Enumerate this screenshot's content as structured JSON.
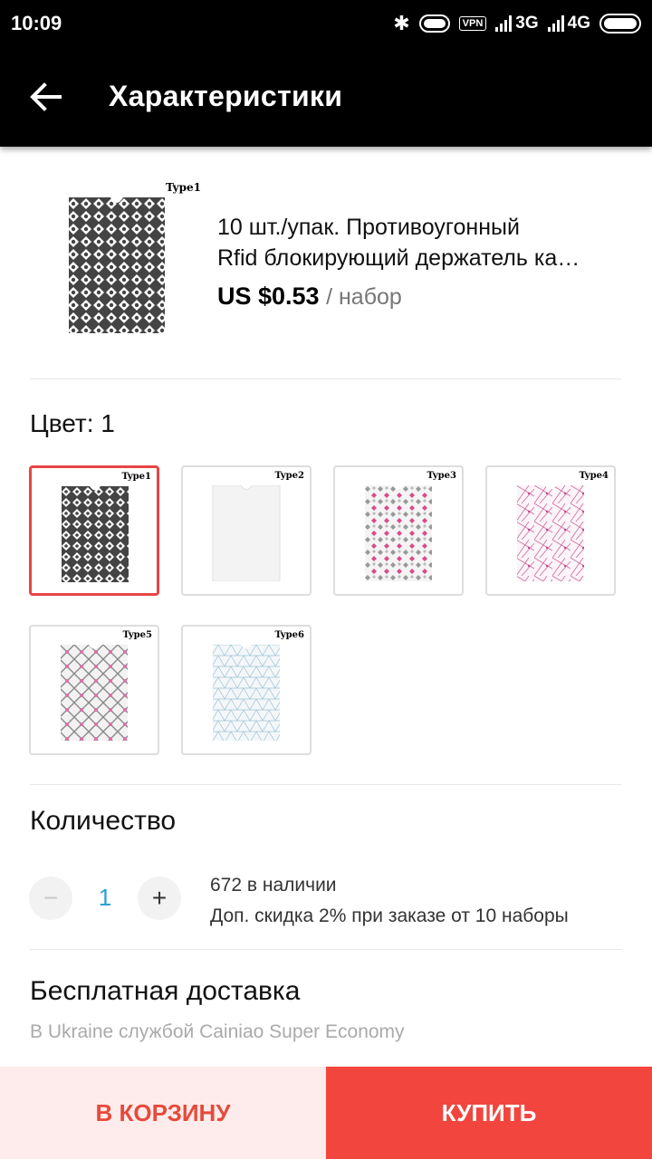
{
  "status_bar": {
    "time": "10:09",
    "vpn_label": "VPN",
    "network_1": "3G",
    "network_2": "4G",
    "icons": [
      "bluetooth-icon",
      "toggle-icon",
      "vpn-icon",
      "signal-icon",
      "signal-icon",
      "battery-icon"
    ]
  },
  "app_bar": {
    "title": "Характеристики",
    "back_icon": "arrow-left-icon"
  },
  "product": {
    "image_label": "Type1",
    "name_line1": "10 шт./упак. Противоугонный",
    "name_line2": "Rfid блокирующий держатель ка…",
    "price": "US $0.53",
    "unit": "/ набор"
  },
  "color": {
    "label": "Цвет: 1",
    "selected": "Type1",
    "options": [
      {
        "label": "Type1",
        "style": "dark-geometric"
      },
      {
        "label": "Type2",
        "style": "plain-white"
      },
      {
        "label": "Type3",
        "style": "grey-pink-diamonds"
      },
      {
        "label": "Type4",
        "style": "pink-network"
      },
      {
        "label": "Type5",
        "style": "grey-pink-lattice"
      },
      {
        "label": "Type6",
        "style": "blue-triangles"
      }
    ]
  },
  "quantity": {
    "label": "Количество",
    "minus": "−",
    "value": "1",
    "plus": "+",
    "stock": "672 в наличии",
    "discount": "Доп. скидка 2% при заказе от 10 наборы"
  },
  "shipping": {
    "title": "Бесплатная доставка",
    "subtitle": "В Ukraine службой Cainiao Super Economy"
  },
  "actions": {
    "cart": "В КОРЗИНУ",
    "buy": "КУПИТЬ"
  },
  "colors": {
    "accent_red": "#f2453d",
    "cart_bg": "#fdeceb",
    "qty_blue": "#2a9fd6",
    "selected_border": "#e84545"
  }
}
